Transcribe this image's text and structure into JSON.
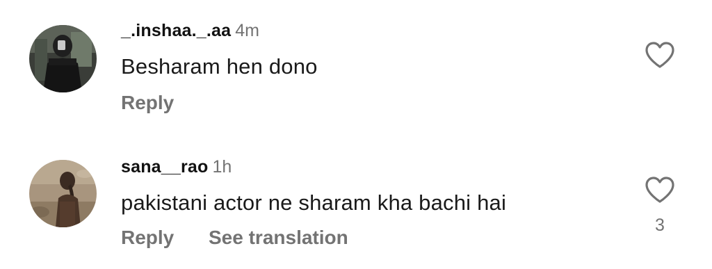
{
  "comments": [
    {
      "username": "_.inshaa._.aa",
      "time": "4m",
      "text": "Besharam hen dono",
      "reply_label": "Reply",
      "avatar_icon": "user-avatar-dark-photo",
      "like_icon": "heart-outline-icon"
    },
    {
      "username": "sana__rao",
      "time": "1h",
      "text": "pakistani actor ne sharam kha bachi hai",
      "reply_label": "Reply",
      "translate_label": "See translation",
      "like_count": "3",
      "avatar_icon": "user-avatar-outdoor-photo",
      "like_icon": "heart-outline-icon"
    }
  ],
  "colors": {
    "text_primary": "#111111",
    "text_secondary": "#737373",
    "background": "#ffffff"
  }
}
